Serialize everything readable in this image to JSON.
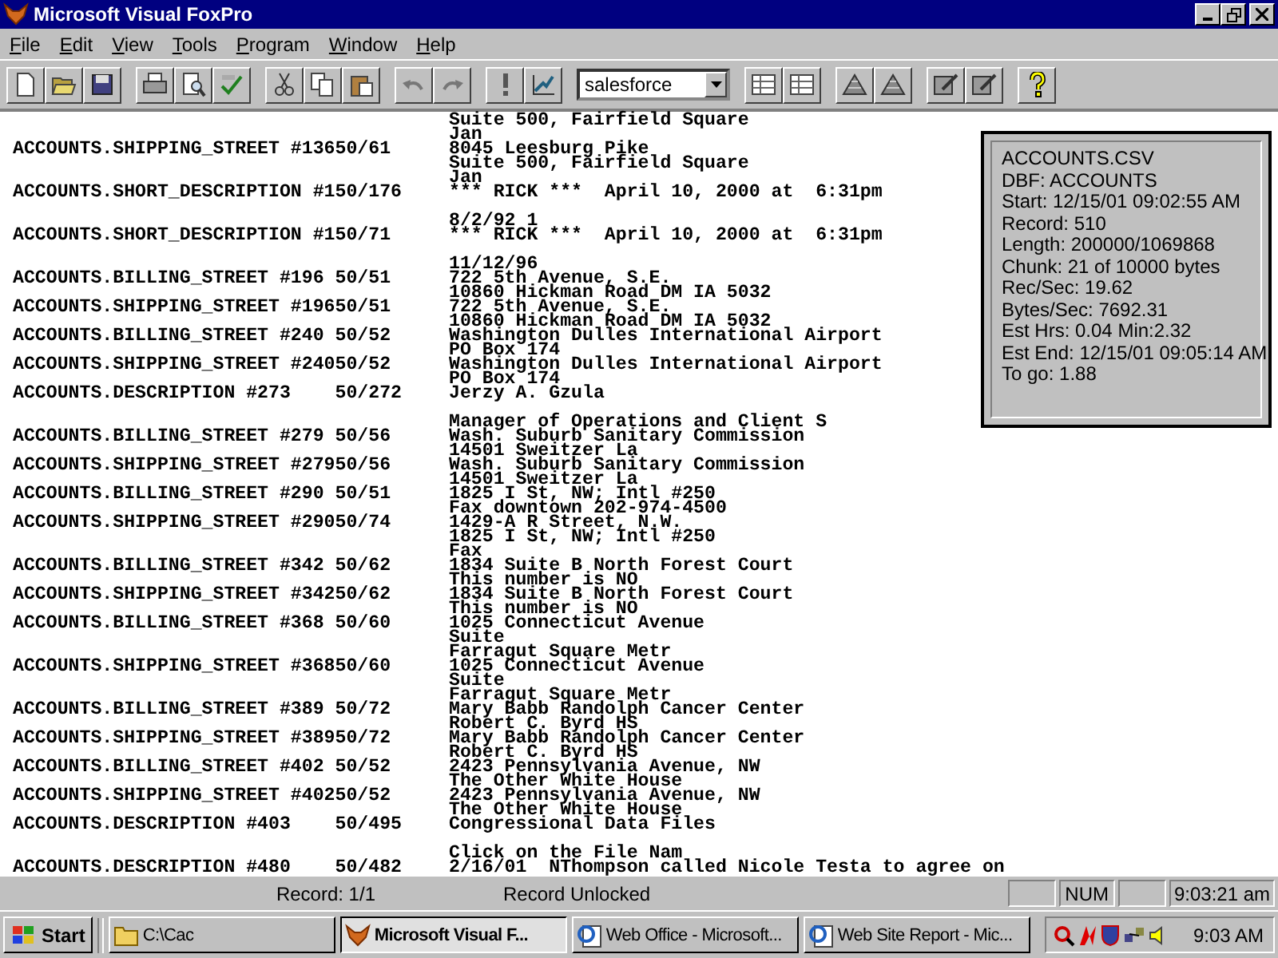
{
  "window": {
    "title": "Microsoft Visual FoxPro"
  },
  "menu": [
    "File",
    "Edit",
    "View",
    "Tools",
    "Program",
    "Window",
    "Help"
  ],
  "toolbar": {
    "database_combo": {
      "value": "salesforce"
    }
  },
  "output_lines": [
    {
      "kind": "continuation",
      "value": "Suite 500, Fairfield Square"
    },
    {
      "kind": "continuation",
      "value": "Jan"
    },
    {
      "kind": "record",
      "field": "ACCOUNTS.SHIPPING_STREET #13650/61",
      "value": "8045 Leesburg Pike"
    },
    {
      "kind": "continuation",
      "value": "Suite 500, Fairfield Square"
    },
    {
      "kind": "continuation",
      "value": "Jan"
    },
    {
      "kind": "record",
      "field": "ACCOUNTS.SHORT_DESCRIPTION #150/176",
      "value": "*** RICK ***  April 10, 2000 at  6:31pm"
    },
    {
      "kind": "blank"
    },
    {
      "kind": "continuation",
      "value": "8/2/92 1"
    },
    {
      "kind": "record",
      "field": "ACCOUNTS.SHORT_DESCRIPTION #150/71",
      "value": "*** RICK ***  April 10, 2000 at  6:31pm"
    },
    {
      "kind": "blank"
    },
    {
      "kind": "continuation",
      "value": "11/12/96"
    },
    {
      "kind": "record",
      "field": "ACCOUNTS.BILLING_STREET #196 50/51",
      "value": "722 5th Avenue, S.E."
    },
    {
      "kind": "continuation",
      "value": "10860 Hickman Road DM IA 5032"
    },
    {
      "kind": "record",
      "field": "ACCOUNTS.SHIPPING_STREET #19650/51",
      "value": "722 5th Avenue, S.E."
    },
    {
      "kind": "continuation",
      "value": "10860 Hickman Road DM IA 5032"
    },
    {
      "kind": "record",
      "field": "ACCOUNTS.BILLING_STREET #240 50/52",
      "value": "Washington Dulles International Airport"
    },
    {
      "kind": "continuation",
      "value": "PO Box 174"
    },
    {
      "kind": "record",
      "field": "ACCOUNTS.SHIPPING_STREET #24050/52",
      "value": "Washington Dulles International Airport"
    },
    {
      "kind": "continuation",
      "value": "PO Box 174"
    },
    {
      "kind": "record",
      "field": "ACCOUNTS.DESCRIPTION #273    50/272",
      "value": "Jerzy A. Gzula"
    },
    {
      "kind": "blank"
    },
    {
      "kind": "continuation",
      "value": "Manager of Operations and Client S"
    },
    {
      "kind": "record",
      "field": "ACCOUNTS.BILLING_STREET #279 50/56",
      "value": "Wash. Suburb Sanitary Commission"
    },
    {
      "kind": "continuation",
      "value": "14501 Sweitzer La"
    },
    {
      "kind": "record",
      "field": "ACCOUNTS.SHIPPING_STREET #27950/56",
      "value": "Wash. Suburb Sanitary Commission"
    },
    {
      "kind": "continuation",
      "value": "14501 Sweitzer La"
    },
    {
      "kind": "record",
      "field": "ACCOUNTS.BILLING_STREET #290 50/51",
      "value": "1825 I St, NW; Intl #250"
    },
    {
      "kind": "continuation",
      "value": "Fax downtown 202-974-4500"
    },
    {
      "kind": "record",
      "field": "ACCOUNTS.SHIPPING_STREET #29050/74",
      "value": "1429-A R Street, N.W."
    },
    {
      "kind": "continuation",
      "value": "1825 I St, NW; Intl #250"
    },
    {
      "kind": "continuation",
      "value": "Fax"
    },
    {
      "kind": "record",
      "field": "ACCOUNTS.BILLING_STREET #342 50/62",
      "value": "1834 Suite B North Forest Court"
    },
    {
      "kind": "continuation",
      "value": "This number is NO"
    },
    {
      "kind": "record",
      "field": "ACCOUNTS.SHIPPING_STREET #34250/62",
      "value": "1834 Suite B North Forest Court"
    },
    {
      "kind": "continuation",
      "value": "This number is NO"
    },
    {
      "kind": "record",
      "field": "ACCOUNTS.BILLING_STREET #368 50/60",
      "value": "1025 Connecticut Avenue"
    },
    {
      "kind": "continuation",
      "value": "Suite"
    },
    {
      "kind": "continuation",
      "value": "Farragut Square Metr"
    },
    {
      "kind": "record",
      "field": "ACCOUNTS.SHIPPING_STREET #36850/60",
      "value": "1025 Connecticut Avenue"
    },
    {
      "kind": "continuation",
      "value": "Suite"
    },
    {
      "kind": "continuation",
      "value": "Farragut Square Metr"
    },
    {
      "kind": "record",
      "field": "ACCOUNTS.BILLING_STREET #389 50/72",
      "value": "Mary Babb Randolph Cancer Center"
    },
    {
      "kind": "continuation",
      "value": "Robert C. Byrd HS"
    },
    {
      "kind": "record",
      "field": "ACCOUNTS.SHIPPING_STREET #38950/72",
      "value": "Mary Babb Randolph Cancer Center"
    },
    {
      "kind": "continuation",
      "value": "Robert C. Byrd HS"
    },
    {
      "kind": "record",
      "field": "ACCOUNTS.BILLING_STREET #402 50/52",
      "value": "2423 Pennsylvania Avenue, NW"
    },
    {
      "kind": "continuation",
      "value": "The Other White House"
    },
    {
      "kind": "record",
      "field": "ACCOUNTS.SHIPPING_STREET #40250/52",
      "value": "2423 Pennsylvania Avenue, NW"
    },
    {
      "kind": "continuation",
      "value": "The Other White House"
    },
    {
      "kind": "record",
      "field": "ACCOUNTS.DESCRIPTION #403    50/495",
      "value": "Congressional Data Files"
    },
    {
      "kind": "blank"
    },
    {
      "kind": "continuation",
      "value": "Click on the File Nam"
    },
    {
      "kind": "record",
      "field": "ACCOUNTS.DESCRIPTION #480    50/482",
      "value": "2/16/01  NThompson called Nicole Testa to agree on"
    }
  ],
  "progress_panel": [
    "ACCOUNTS.CSV",
    "DBF: ACCOUNTS",
    "Start: 12/15/01 09:02:55 AM",
    "Record: 510",
    "Length: 200000/1069868",
    "Chunk: 21 of 10000 bytes",
    "Rec/Sec: 19.62",
    "Bytes/Sec: 7692.31",
    "Est Hrs: 0.04 Min:2.32",
    "Est End: 12/15/01 09:05:14 AM",
    "To go: 1.88"
  ],
  "status_bar": {
    "record": "Record: 1/1",
    "lock": "Record Unlocked",
    "num": "NUM",
    "time": "9:03:21 am"
  },
  "taskbar": {
    "start": "Start",
    "tasks": [
      {
        "label": "C:\\Cac",
        "kind": "folder",
        "selected": false
      },
      {
        "label": "Microsoft Visual F...",
        "kind": "app",
        "selected": true
      },
      {
        "label": "Web Office - Microsoft...",
        "kind": "browser",
        "selected": false
      },
      {
        "label": "Web Site Report - Mic...",
        "kind": "browser",
        "selected": false
      }
    ],
    "clock": "9:03 AM"
  }
}
